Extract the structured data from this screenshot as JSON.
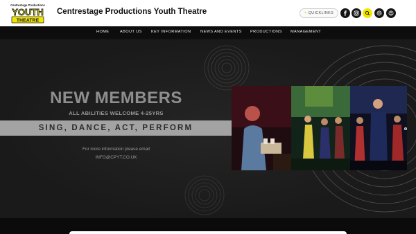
{
  "header": {
    "logo_text": [
      "Centrestage Productions",
      "YOUTH",
      "THEATRE"
    ],
    "title": "Centrestage Productions Youth Theatre",
    "quicklinks_label": "QUICKLINKS",
    "quicklinks_icon": "plus-icon",
    "social": [
      "facebook-icon",
      "instagram-icon",
      "search-icon",
      "email-icon",
      "account-icon"
    ]
  },
  "nav": {
    "items": [
      "HOME",
      "ABOUT US",
      "KEY INFORMATION",
      "NEWS AND EVENTS",
      "PRODUCTIONS",
      "MANAGEMENT"
    ]
  },
  "hero": {
    "headline": "NEW MEMBERS",
    "subhead": "ALL ABILITIES WELCOME 4-25YRS",
    "banner": "SING, DANCE, ACT, PERFORM",
    "info_line1": "For more information please email",
    "info_line2": "INFO@CPYT.CO.UK"
  },
  "colors": {
    "accent": "#f2e600",
    "dark": "#111111",
    "banner_grey": "#a3a3a3",
    "text_grey": "#9a9a9a"
  }
}
